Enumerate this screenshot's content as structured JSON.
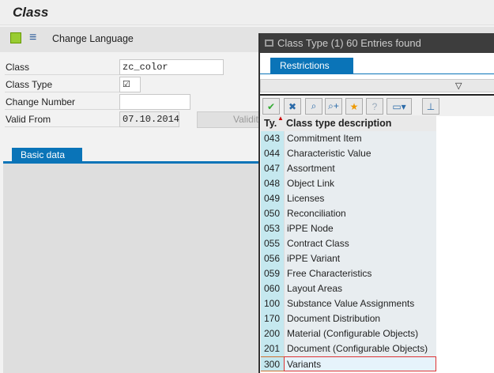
{
  "window": {
    "title": "Class"
  },
  "toolbar": {
    "change_language": "Change Language"
  },
  "form": {
    "class_label": "Class",
    "class_value": "zc_color",
    "class_type_label": "Class Type",
    "class_type_value": "☑",
    "change_number_label": "Change Number",
    "change_number_value": "",
    "valid_from_label": "Valid From",
    "valid_from_value": "07.10.2014",
    "validity_button": "Validity"
  },
  "tabs": {
    "basic_data": "Basic data"
  },
  "popup": {
    "title": "Class Type (1)   60 Entries found",
    "restrictions_tab": "Restrictions",
    "columns": {
      "type": "Ty.",
      "description": "Class type description"
    },
    "rows": [
      {
        "type": "043",
        "desc": "Commitment Item"
      },
      {
        "type": "044",
        "desc": "Characteristic Value"
      },
      {
        "type": "047",
        "desc": "Assortment"
      },
      {
        "type": "048",
        "desc": "Object Link"
      },
      {
        "type": "049",
        "desc": "Licenses"
      },
      {
        "type": "050",
        "desc": "Reconciliation"
      },
      {
        "type": "053",
        "desc": "iPPE Node"
      },
      {
        "type": "055",
        "desc": "Contract Class"
      },
      {
        "type": "056",
        "desc": "iPPE Variant"
      },
      {
        "type": "059",
        "desc": "Free Characteristics"
      },
      {
        "type": "060",
        "desc": "Layout Areas"
      },
      {
        "type": "100",
        "desc": "Substance Value Assignments"
      },
      {
        "type": "170",
        "desc": "Document Distribution"
      },
      {
        "type": "200",
        "desc": "Material (Configurable Objects)"
      },
      {
        "type": "201",
        "desc": "Document (Configurable Objects)"
      },
      {
        "type": "300",
        "desc": "Variants"
      }
    ]
  }
}
